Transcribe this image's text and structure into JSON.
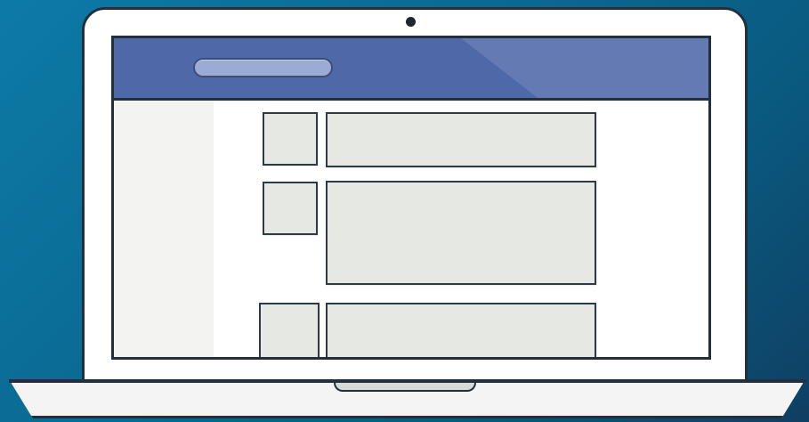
{
  "illustration": {
    "subject": "laptop-with-social-feed-wireframe",
    "colors": {
      "background": "#0a6891",
      "laptop_body": "#ffffff",
      "outline": "#22303e",
      "topbar": "#4f68a8",
      "searchbar": "#9bacd2",
      "content_block": "#e6e8e4",
      "sidebar": "#f3f4f2"
    },
    "feed": {
      "posts": [
        {
          "name": "post-1"
        },
        {
          "name": "post-2"
        },
        {
          "name": "post-3"
        }
      ]
    }
  }
}
